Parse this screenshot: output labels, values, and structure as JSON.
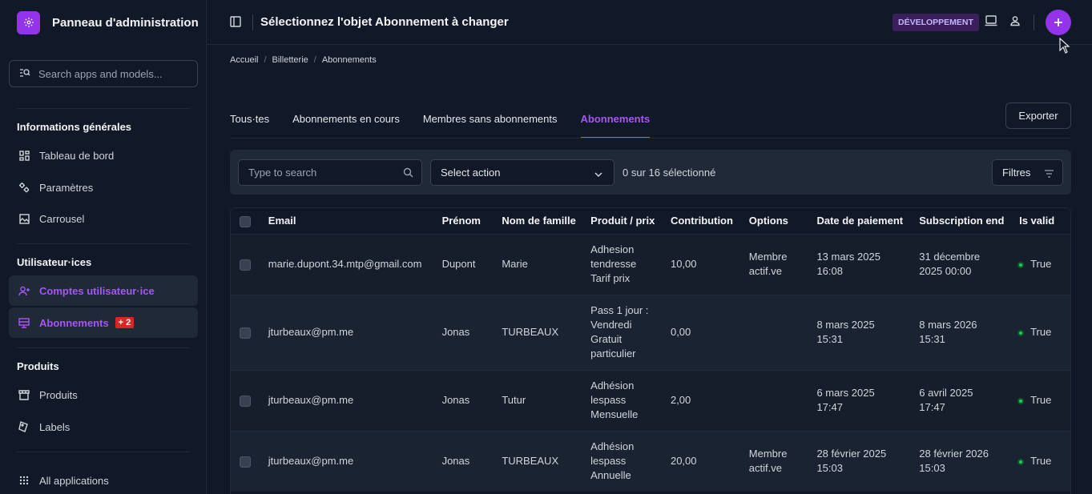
{
  "brand": {
    "title": "Panneau d'administration"
  },
  "sidebar": {
    "search_placeholder": "Search apps and models...",
    "groups": [
      {
        "label": "Informations générales"
      },
      {
        "label": "Utilisateur·ices"
      },
      {
        "label": "Produits"
      }
    ],
    "items": [
      {
        "label": "Tableau de bord",
        "icon": "dashboard-icon"
      },
      {
        "label": "Paramètres",
        "icon": "settings-icon"
      },
      {
        "label": "Carrousel",
        "icon": "image-icon"
      },
      {
        "label": "Comptes utilisateur·ice",
        "icon": "user-add-icon"
      },
      {
        "label": "Abonnements",
        "icon": "card-icon",
        "badge": "+ 2"
      },
      {
        "label": "Produits",
        "icon": "store-icon"
      },
      {
        "label": "Labels",
        "icon": "label-icon"
      },
      {
        "label": "All applications",
        "icon": "apps-grid-icon"
      }
    ]
  },
  "header": {
    "title": "Sélectionnez l'objet Abonnement à changer",
    "env_badge": "DÉVELOPPEMENT"
  },
  "breadcrumb": [
    "Accueil",
    "Billetterie",
    "Abonnements"
  ],
  "tabs": [
    {
      "label": "Tous·tes"
    },
    {
      "label": "Abonnements en cours"
    },
    {
      "label": "Membres sans abonnements"
    },
    {
      "label": "Abonnements"
    }
  ],
  "export_label": "Exporter",
  "toolbar": {
    "search_placeholder": "Type to search",
    "action_label": "Select action",
    "count_text": "0 sur 16 sélectionné",
    "filter_label": "Filtres"
  },
  "table": {
    "columns": [
      "Email",
      "Prénom",
      "Nom de famille",
      "Produit / prix",
      "Contribution",
      "Options",
      "Date de paiement",
      "Subscription end",
      "Is valid"
    ],
    "rows": [
      {
        "email": "marie.dupont.34.mtp@gmail.com",
        "prenom": "Dupont",
        "nom": "Marie",
        "produit": [
          "Adhesion",
          "tendresse",
          "Tarif prix"
        ],
        "contribution": "10,00",
        "options": [
          "Membre",
          "actif.ve"
        ],
        "date_paiement": [
          "13 mars 2025",
          "16:08"
        ],
        "sub_end": [
          "31 décembre",
          "2025 00:00"
        ],
        "valid": "True"
      },
      {
        "email": "jturbeaux@pm.me",
        "prenom": "Jonas",
        "nom": "TURBEAUX",
        "produit": [
          "Pass 1 jour :",
          "Vendredi",
          "Gratuit",
          "particulier"
        ],
        "contribution": "0,00",
        "options": [],
        "date_paiement": [
          "8 mars 2025",
          "15:31"
        ],
        "sub_end": [
          "8 mars 2026",
          "15:31"
        ],
        "valid": "True"
      },
      {
        "email": "jturbeaux@pm.me",
        "prenom": "Jonas",
        "nom": "Tutur",
        "produit": [
          "Adhésion",
          "lespass",
          "Mensuelle"
        ],
        "contribution": "2,00",
        "options": [],
        "date_paiement": [
          "6 mars 2025",
          "17:47"
        ],
        "sub_end": [
          "6 avril 2025",
          "17:47"
        ],
        "valid": "True"
      },
      {
        "email": "jturbeaux@pm.me",
        "prenom": "Jonas",
        "nom": "TURBEAUX",
        "produit": [
          "Adhésion",
          "lespass",
          "Annuelle"
        ],
        "contribution": "20,00",
        "options": [
          "Membre",
          "actif.ve"
        ],
        "date_paiement": [
          "28 février 2025",
          "15:03"
        ],
        "sub_end": [
          "28 février 2026",
          "15:03"
        ],
        "valid": "True"
      }
    ]
  },
  "colors": {
    "accent": "#a855f7",
    "brand": "#9333ea",
    "valid": "#22c55e",
    "badge": "#dc2626"
  }
}
